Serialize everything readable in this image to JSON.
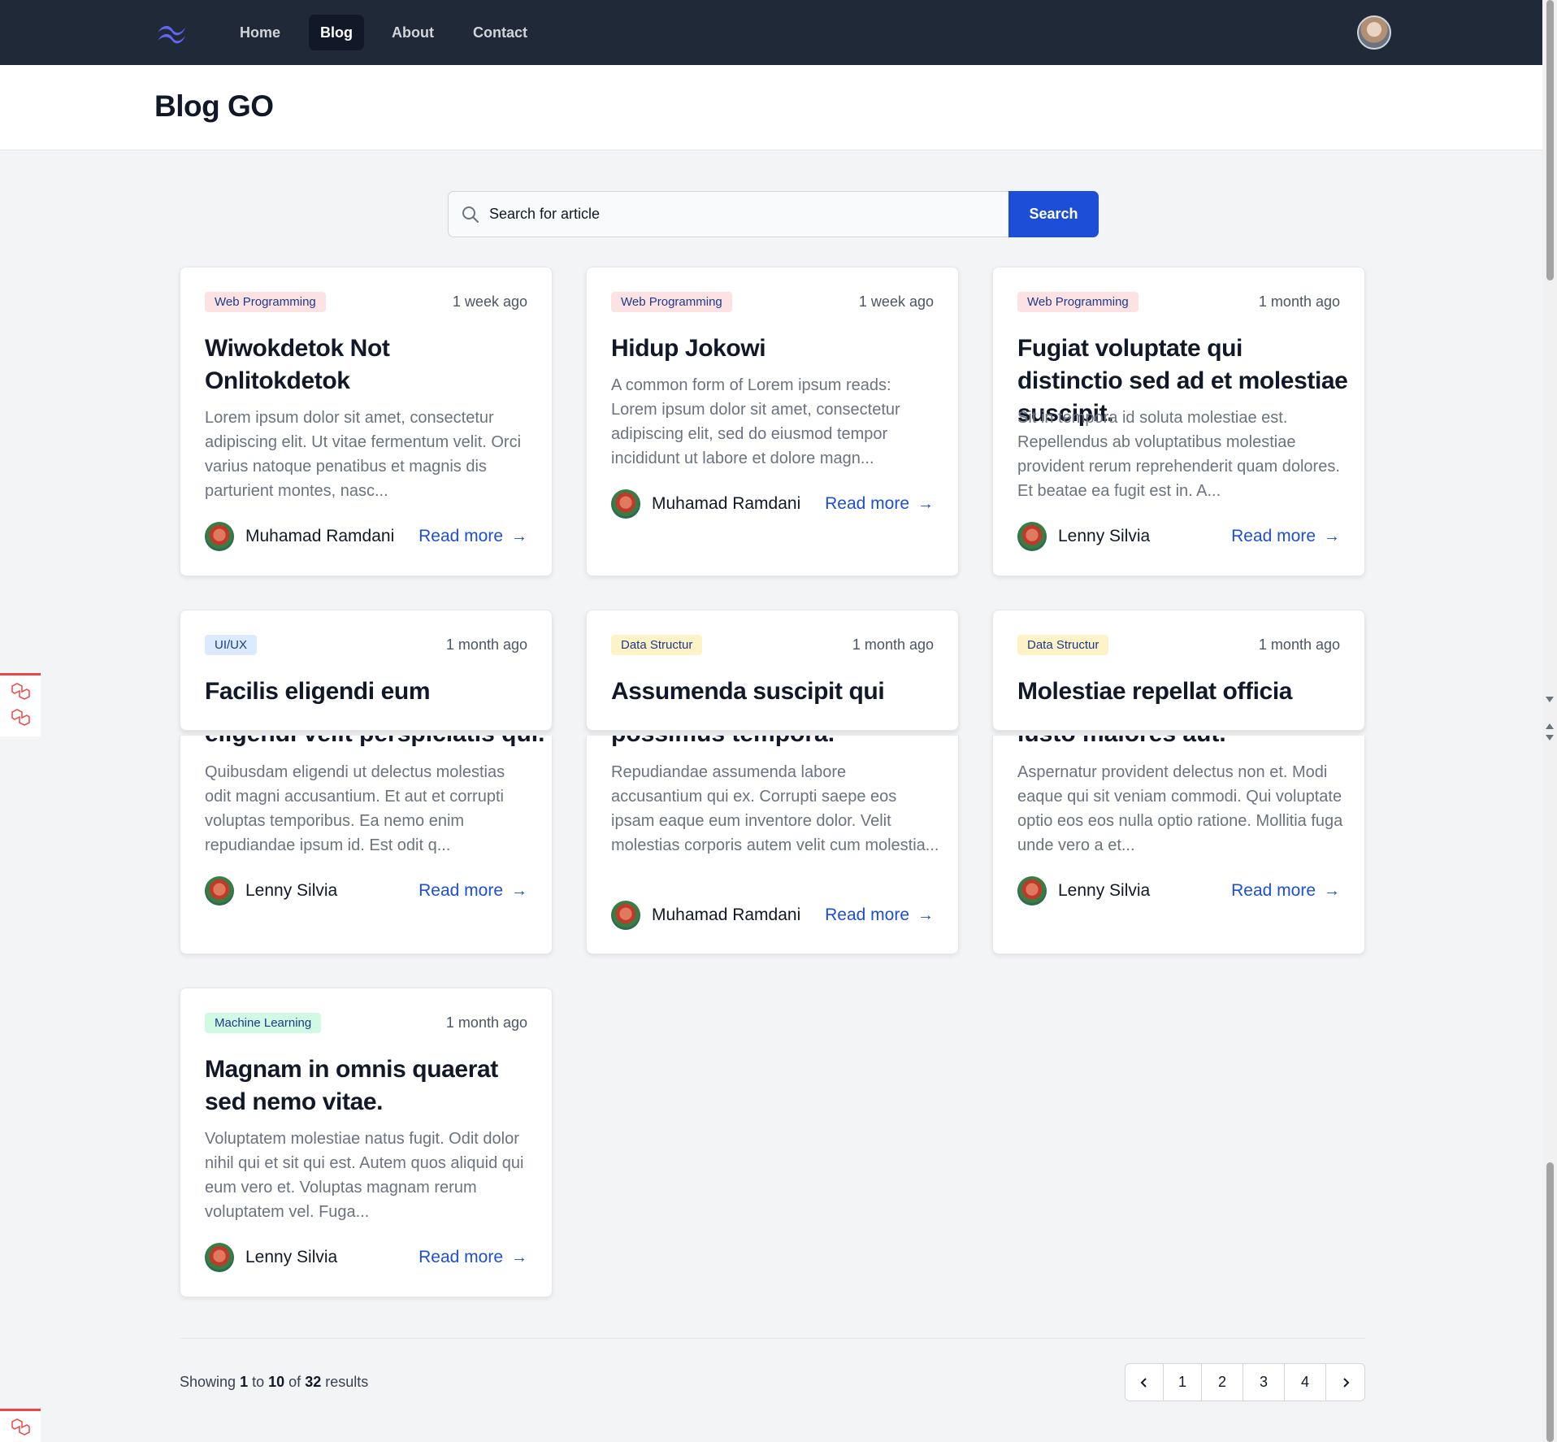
{
  "nav": {
    "items": [
      {
        "label": "Home",
        "active": false
      },
      {
        "label": "Blog",
        "active": true
      },
      {
        "label": "About",
        "active": false
      },
      {
        "label": "Contact",
        "active": false
      }
    ],
    "logo_icon": "tailwind-wave-logo",
    "logo_color": "#6366f1"
  },
  "header": {
    "title": "Blog GO"
  },
  "search": {
    "placeholder": "Search for article",
    "button_label": "Search"
  },
  "posts": [
    {
      "category": "Web Programming",
      "time": "1 week ago",
      "title": "Wiwokdetok Not Onlitokdetok",
      "excerpt": "Lorem ipsum dolor sit amet, consectetur adipiscing elit. Ut vitae fermentum velit. Orci varius natoque penatibus et magnis dis parturient montes, nasc...",
      "author": "Muhamad Ramdani",
      "read_more": "Read more"
    },
    {
      "category": "Web Programming",
      "time": "1 week ago",
      "title": "Hidup Jokowi",
      "excerpt": "A common form of Lorem ipsum reads: Lorem ipsum dolor sit amet, consectetur adipiscing elit, sed do eiusmod tempor incididunt ut labore et dolore magn...",
      "author": "Muhamad Ramdani",
      "read_more": "Read more"
    },
    {
      "category": "Web Programming",
      "time": "1 month ago",
      "title": "Fugiat voluptate qui distinctio sed ad et molestiae suscipit.",
      "excerpt": "Sit in tempora id soluta molestiae est. Repellendus ab voluptatibus molestiae provident rerum reprehenderit quam dolores. Et beatae ea fugit est in. A...",
      "author": "Lenny Silvia",
      "read_more": "Read more"
    },
    {
      "category": "UI/UX",
      "time": "1 month ago",
      "title": "Facilis eligendi eum",
      "title_overflow": "eligendi velit perspiciatis qui.",
      "excerpt": "Quibusdam eligendi ut delectus molestias odit magni accusantium. Et aut et corrupti voluptas temporibus. Ea nemo enim repudiandae ipsum id. Est odit q...",
      "author": "Lenny Silvia",
      "read_more": "Read more"
    },
    {
      "category": "Data Structur",
      "time": "1 month ago",
      "title": "Assumenda suscipit qui",
      "title_overflow": "possimus tempora.",
      "excerpt": "Repudiandae assumenda labore accusantium qui ex. Corrupti saepe eos ipsam eaque eum inventore dolor. Velit molestias corporis autem velit cum molestia...",
      "author": "Muhamad Ramdani",
      "read_more": "Read more"
    },
    {
      "category": "Data Structur",
      "time": "1 month ago",
      "title": "Molestiae repellat officia",
      "title_overflow": "iusto maiores aut.",
      "excerpt": "Aspernatur provident delectus non et. Modi eaque qui sit veniam commodi. Qui voluptate optio eos eos nulla optio ratione. Mollitia fuga unde vero a et...",
      "author": "Lenny Silvia",
      "read_more": "Read more"
    },
    {
      "category": "Machine Learning",
      "time": "1 month ago",
      "title": "Magnam in omnis quaerat sed nemo vitae.",
      "excerpt": "Voluptatem molestiae natus fugit. Odit dolor nihil qui et sit qui est. Autem quos aliquid qui eum vero et. Voluptas magnam rerum voluptatem vel. Fuga...",
      "author": "Lenny Silvia",
      "read_more": "Read more"
    }
  ],
  "pagination": {
    "showing_prefix": "Showing",
    "from": "1",
    "to_word": "to",
    "to": "10",
    "of_word": "of",
    "total": "32",
    "results_word": "results",
    "pages": [
      "1",
      "2",
      "3",
      "4"
    ],
    "prev_icon": "chevron-left-icon",
    "next_icon": "chevron-right-icon"
  },
  "colors": {
    "navbar": "#1f2937",
    "accent": "#1d4ed8",
    "page_bg": "#f3f4f6"
  }
}
